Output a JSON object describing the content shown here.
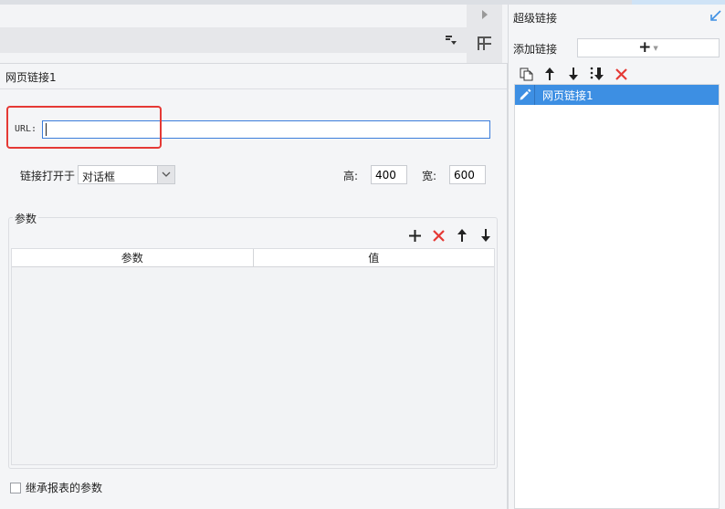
{
  "hyperlink_panel": {
    "title": "超级链接",
    "add_label": "添加链接",
    "add_button_symbol": "+",
    "items": [
      {
        "label": "网页链接1",
        "selected": true
      }
    ],
    "toolbar_icons": [
      "copy-icon",
      "move-up-icon",
      "move-down-icon",
      "sort-icon",
      "delete-icon"
    ]
  },
  "editor": {
    "link_name": "网页链接1",
    "url_label": "URL:",
    "url_value": "",
    "open_in_label": "链接打开于",
    "open_in_value": "对话框",
    "height_label": "高:",
    "height_value": "400",
    "width_label": "宽:",
    "width_value": "600",
    "params_group_label": "参数",
    "params_columns": [
      "参数",
      "值"
    ],
    "params_rows": [],
    "param_tool_icons": [
      "add-icon",
      "delete-icon",
      "move-up-icon",
      "move-down-icon"
    ],
    "inherit_label": "继承报表的参数",
    "inherit_checked": false
  },
  "colors": {
    "accent": "#3d8fe3",
    "highlight": "#e53935",
    "delete": "#e53935",
    "input_focus": "#3b7ddb"
  }
}
